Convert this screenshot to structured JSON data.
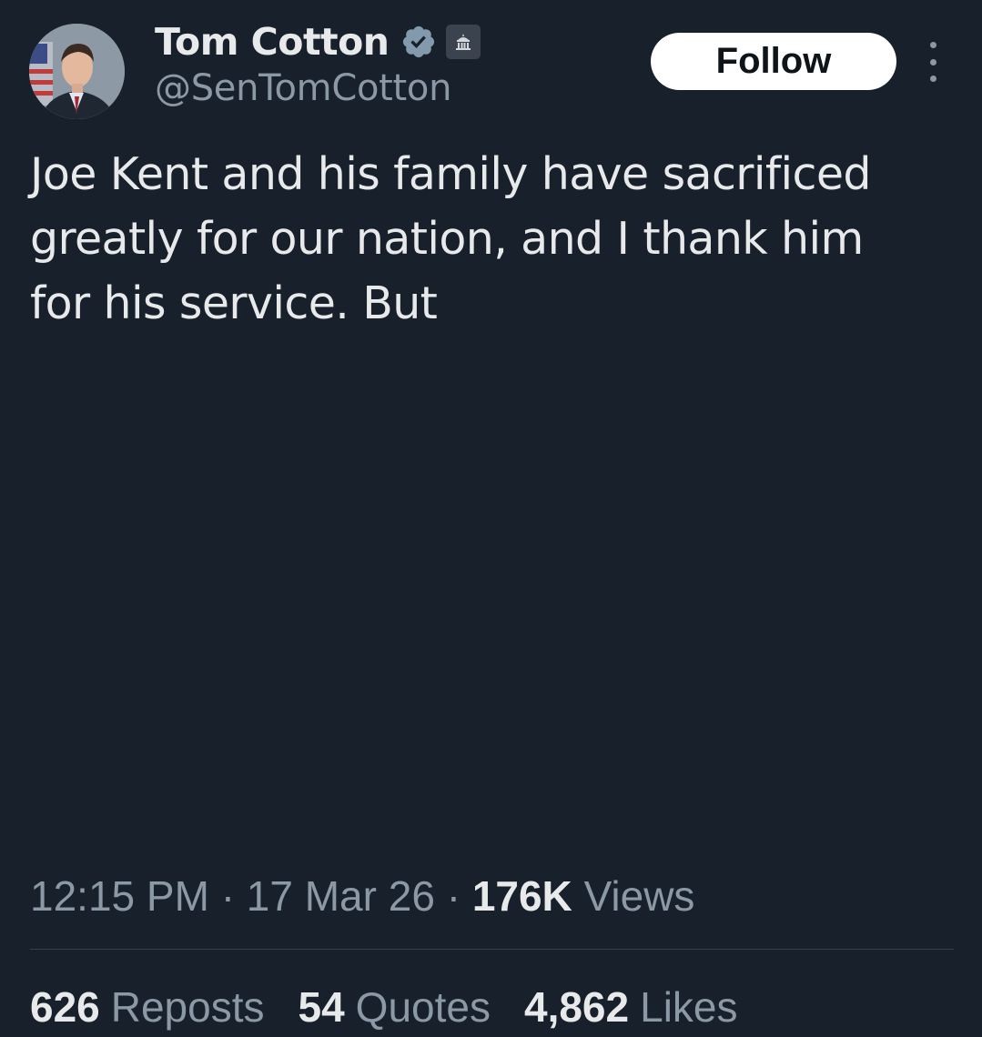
{
  "author": {
    "display_name": "Tom Cotton",
    "handle": "@SenTomCotton",
    "verified_icon": "verified-badge-icon",
    "affiliation_icon": "government-building-icon"
  },
  "actions": {
    "follow_label": "Follow",
    "more_icon": "more-vertical-icon"
  },
  "tweet": {
    "text": "Joe Kent and his family have sacrificed\ngreatly for our nation, and I thank him\nfor his service. But"
  },
  "meta": {
    "time": "12:15 PM",
    "separator": "·",
    "date": "17 Mar 26",
    "views_count": "176K",
    "views_label": "Views"
  },
  "stats": {
    "reposts_count": "626",
    "reposts_label": "Reposts",
    "quotes_count": "54",
    "quotes_label": "Quotes",
    "likes_count": "4,862",
    "likes_label": "Likes"
  },
  "colors": {
    "background": "#18202b",
    "text_primary": "#e7e9ea",
    "text_secondary": "#8b98a5",
    "verified_badge": "#829aab",
    "follow_button_bg": "#ffffff"
  }
}
